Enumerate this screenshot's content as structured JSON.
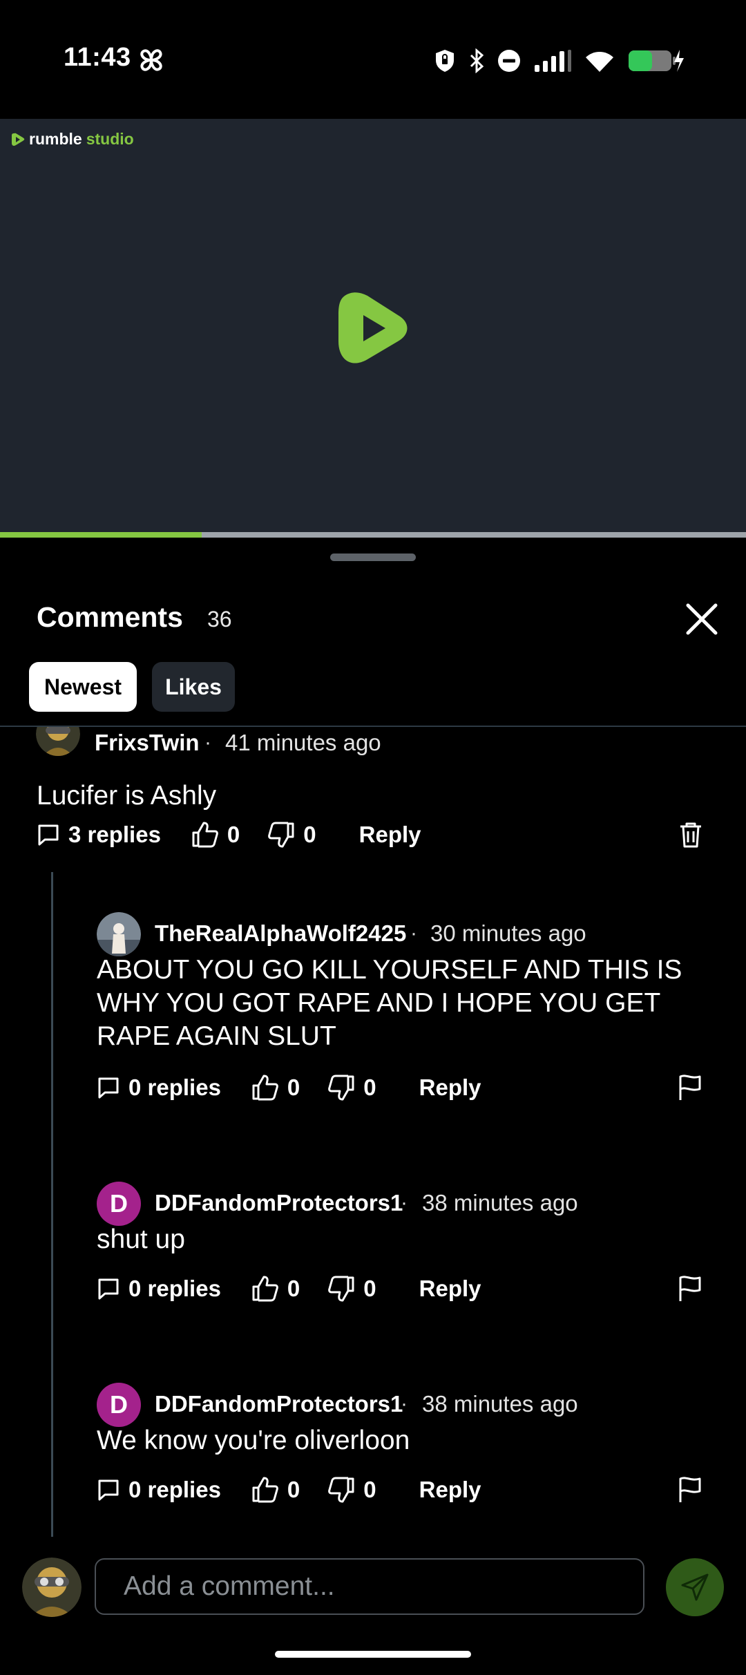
{
  "status_bar": {
    "time": "11:43",
    "battery_color": "#34c759"
  },
  "video": {
    "brand_name": "rumble",
    "brand_suffix": "studio",
    "accent": "#85c742",
    "progress_fraction": 0.27
  },
  "comments": {
    "title": "Comments",
    "count": "36",
    "sort_tabs": [
      {
        "label": "Newest",
        "active": true
      },
      {
        "label": "Likes",
        "active": false
      }
    ],
    "items": [
      {
        "user": "FrixsTwin",
        "separator": "·",
        "ago": "41 minutes ago",
        "text": "Lucifer is Ashly",
        "replies": "3 replies",
        "likes": "0",
        "dislikes": "0",
        "reply_label": "Reply",
        "trailing_icon": "trash-icon"
      },
      {
        "user": "TheRealAlphaWolf2425",
        "separator": "·",
        "ago": "30 minutes ago",
        "text": "ABOUT YOU GO KILL YOURSELF AND THIS IS WHY YOU GOT RAPE AND I HOPE YOU GET RAPE AGAIN SLUT",
        "replies": "0 replies",
        "likes": "0",
        "dislikes": "0",
        "reply_label": "Reply",
        "trailing_icon": "flag-icon"
      },
      {
        "user": "DDFandomProtectors1",
        "avatar_letter": "D",
        "avatar_color": "#a4228c",
        "separator": "·",
        "ago": "38 minutes ago",
        "text": "shut up",
        "replies": "0 replies",
        "likes": "0",
        "dislikes": "0",
        "reply_label": "Reply",
        "trailing_icon": "flag-icon"
      },
      {
        "user": "DDFandomProtectors1",
        "avatar_letter": "D",
        "avatar_color": "#a4228c",
        "separator": "·",
        "ago": "38 minutes ago",
        "text": "We know you're oliverloon",
        "replies": "0 replies",
        "likes": "0",
        "dislikes": "0",
        "reply_label": "Reply",
        "trailing_icon": "flag-icon"
      }
    ]
  },
  "composer": {
    "placeholder": "Add a comment...",
    "send_color": "#2f5a18"
  }
}
